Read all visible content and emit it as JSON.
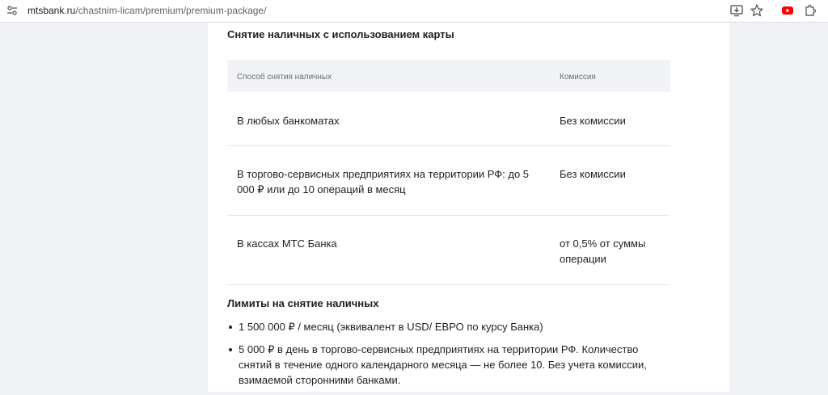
{
  "browser": {
    "url_host": "mtsbank.ru",
    "url_path": "/chastnim-licam/premium/premium-package/"
  },
  "section1": {
    "title": "Снятие наличных с использованием карты",
    "table": {
      "headers": [
        "Способ снятия наличных",
        "Комиссия"
      ],
      "rows": [
        {
          "method": "В любых банкоматах",
          "fee": "Без комиссии"
        },
        {
          "method": "В торгово-сервисных предприятиях на территории РФ: до 5 000 ₽ или до 10 операций в месяц",
          "fee": "Без комиссии"
        },
        {
          "method": "В кассах МТС Банка",
          "fee": "от 0,5% от суммы операции"
        }
      ]
    }
  },
  "section2": {
    "title": "Лимиты на снятие наличных",
    "items": [
      "1 500 000 ₽ / месяц (эквивалент в USD/ ЕВРО по курсу Банка)",
      "5 000 ₽ в день в торгово-сервисных предприятиях на территории РФ. Количество снятий в течение одного календарного месяца — не более 10. Без учета комиссии, взимаемой сторонними банками."
    ]
  },
  "icons": [
    "tune-icon",
    "install-icon",
    "star-icon",
    "youtube-icon",
    "extensions-icon"
  ],
  "colors": {
    "page_bg": "#f2f3f7",
    "card_bg": "#ffffff",
    "header_bg": "#f2f3f7",
    "text": "#1d2023",
    "muted": "#626c77",
    "youtube_red": "#ff0000"
  }
}
